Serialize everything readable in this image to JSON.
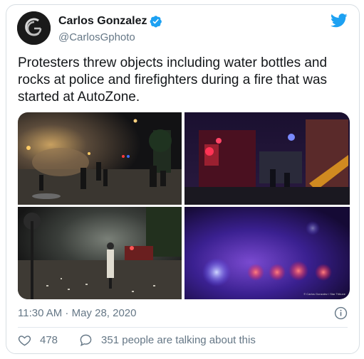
{
  "author": {
    "name": "Carlos Gonzalez",
    "handle": "@CarlosGphoto",
    "verified": true
  },
  "tweet": {
    "text": "Protesters threw objects including water bottles and rocks at police and firefighters during a fire that was started at AutoZone.",
    "timestamp": "11:30 AM · May 28, 2020",
    "watermark": "© Carlos Gonzalez / Star Tribune"
  },
  "actions": {
    "likes": "478",
    "conversation": "351 people are talking about this"
  },
  "icons": {
    "brand": "twitter-bird-icon",
    "verified": "verified-badge-icon",
    "info": "info-icon",
    "like": "heart-icon",
    "reply": "speech-bubble-icon"
  },
  "colors": {
    "brand_blue": "#1da1f2",
    "text": "#14171a",
    "secondary": "#657786"
  }
}
